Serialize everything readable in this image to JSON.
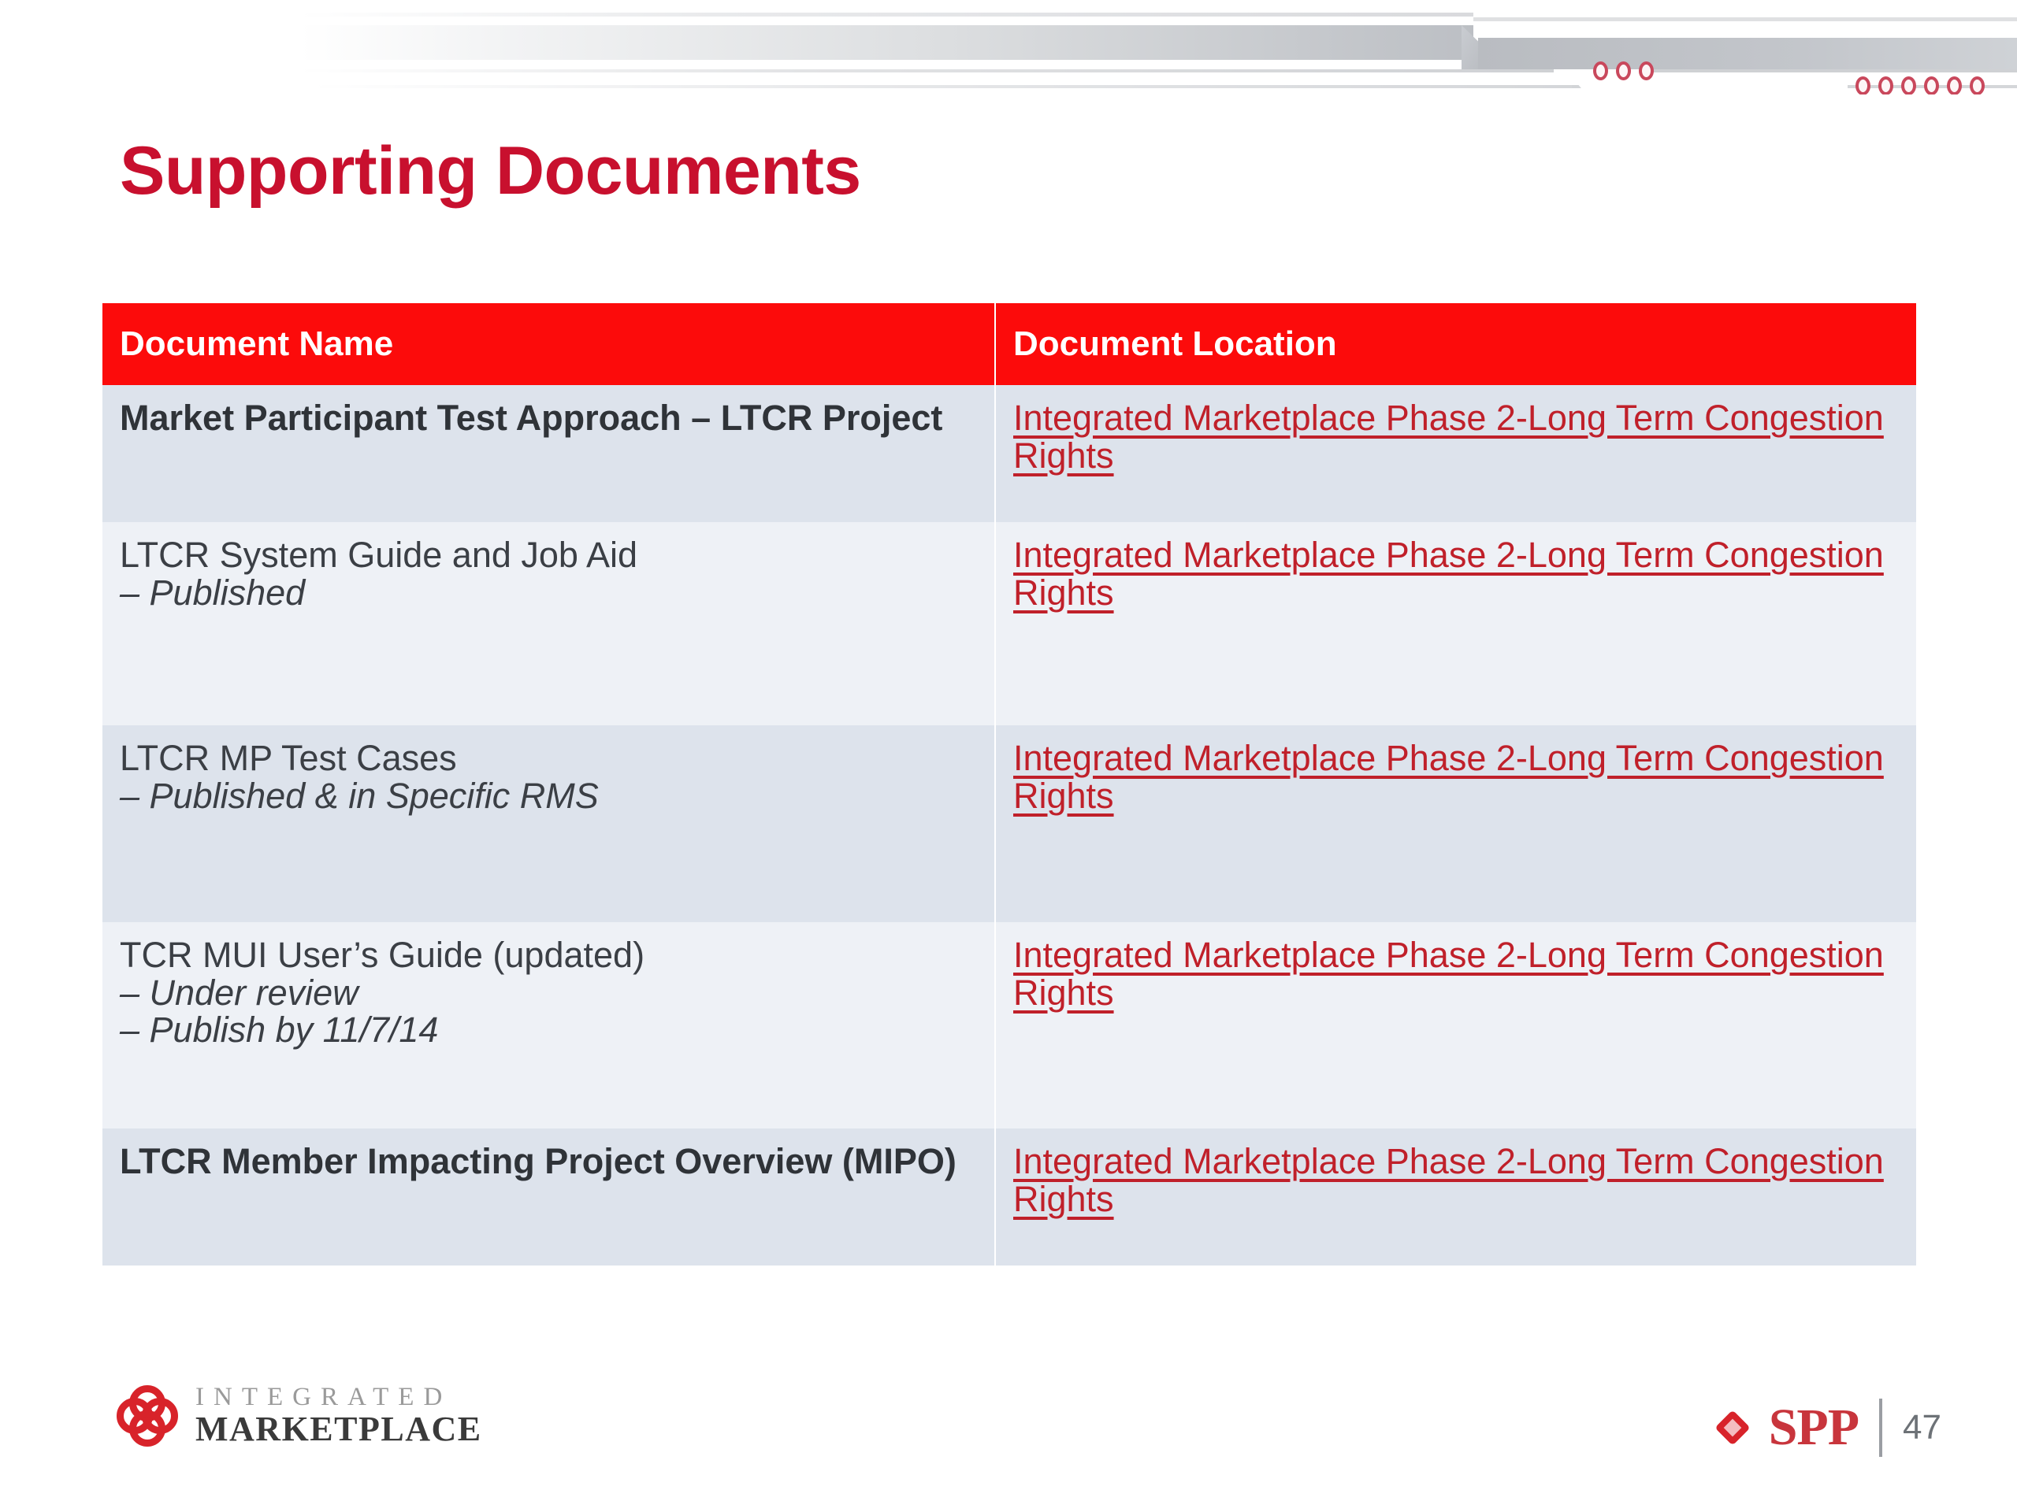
{
  "slide": {
    "title": "Supporting Documents",
    "page_number": "47",
    "accent_red": "#C8102E",
    "header_red": "#FC0B0B",
    "link_red": "#C0202A",
    "band_dark": "#dde3ec",
    "band_light": "#eef1f6"
  },
  "table": {
    "headers": {
      "name": "Document Name",
      "location": "Document Location"
    },
    "rows": [
      {
        "name": "Market Participant Test Approach – LTCR Project",
        "bold": true,
        "subs": [],
        "location": "Integrated Marketplace Phase 2-Long Term Congestion Rights"
      },
      {
        "name": "LTCR System Guide and Job Aid",
        "bold": false,
        "subs": [
          "– Published"
        ],
        "location": "Integrated Marketplace Phase 2-Long Term Congestion Rights"
      },
      {
        "name": "LTCR MP Test Cases",
        "bold": false,
        "subs": [
          "– Published & in Specific RMS"
        ],
        "location": "Integrated Marketplace Phase 2-Long Term Congestion Rights"
      },
      {
        "name": "TCR MUI User’s Guide (updated)",
        "bold": false,
        "subs": [
          "– Under review",
          "– Publish by 11/7/14"
        ],
        "location": "Integrated Marketplace Phase 2-Long Term Congestion Rights"
      },
      {
        "name": "LTCR Member Impacting Project Overview (MIPO)",
        "bold": true,
        "subs": [],
        "location": "Integrated Marketplace Phase 2-Long Term Congestion Rights"
      }
    ]
  },
  "footer": {
    "logo_line1": "INTEGRATED",
    "logo_line2": "MARKETPLACE",
    "spp_word": "SPP"
  },
  "decoration": {
    "dots_group_a_count": 3,
    "dots_group_b_count": 6,
    "dot_color": "#c9485c"
  }
}
